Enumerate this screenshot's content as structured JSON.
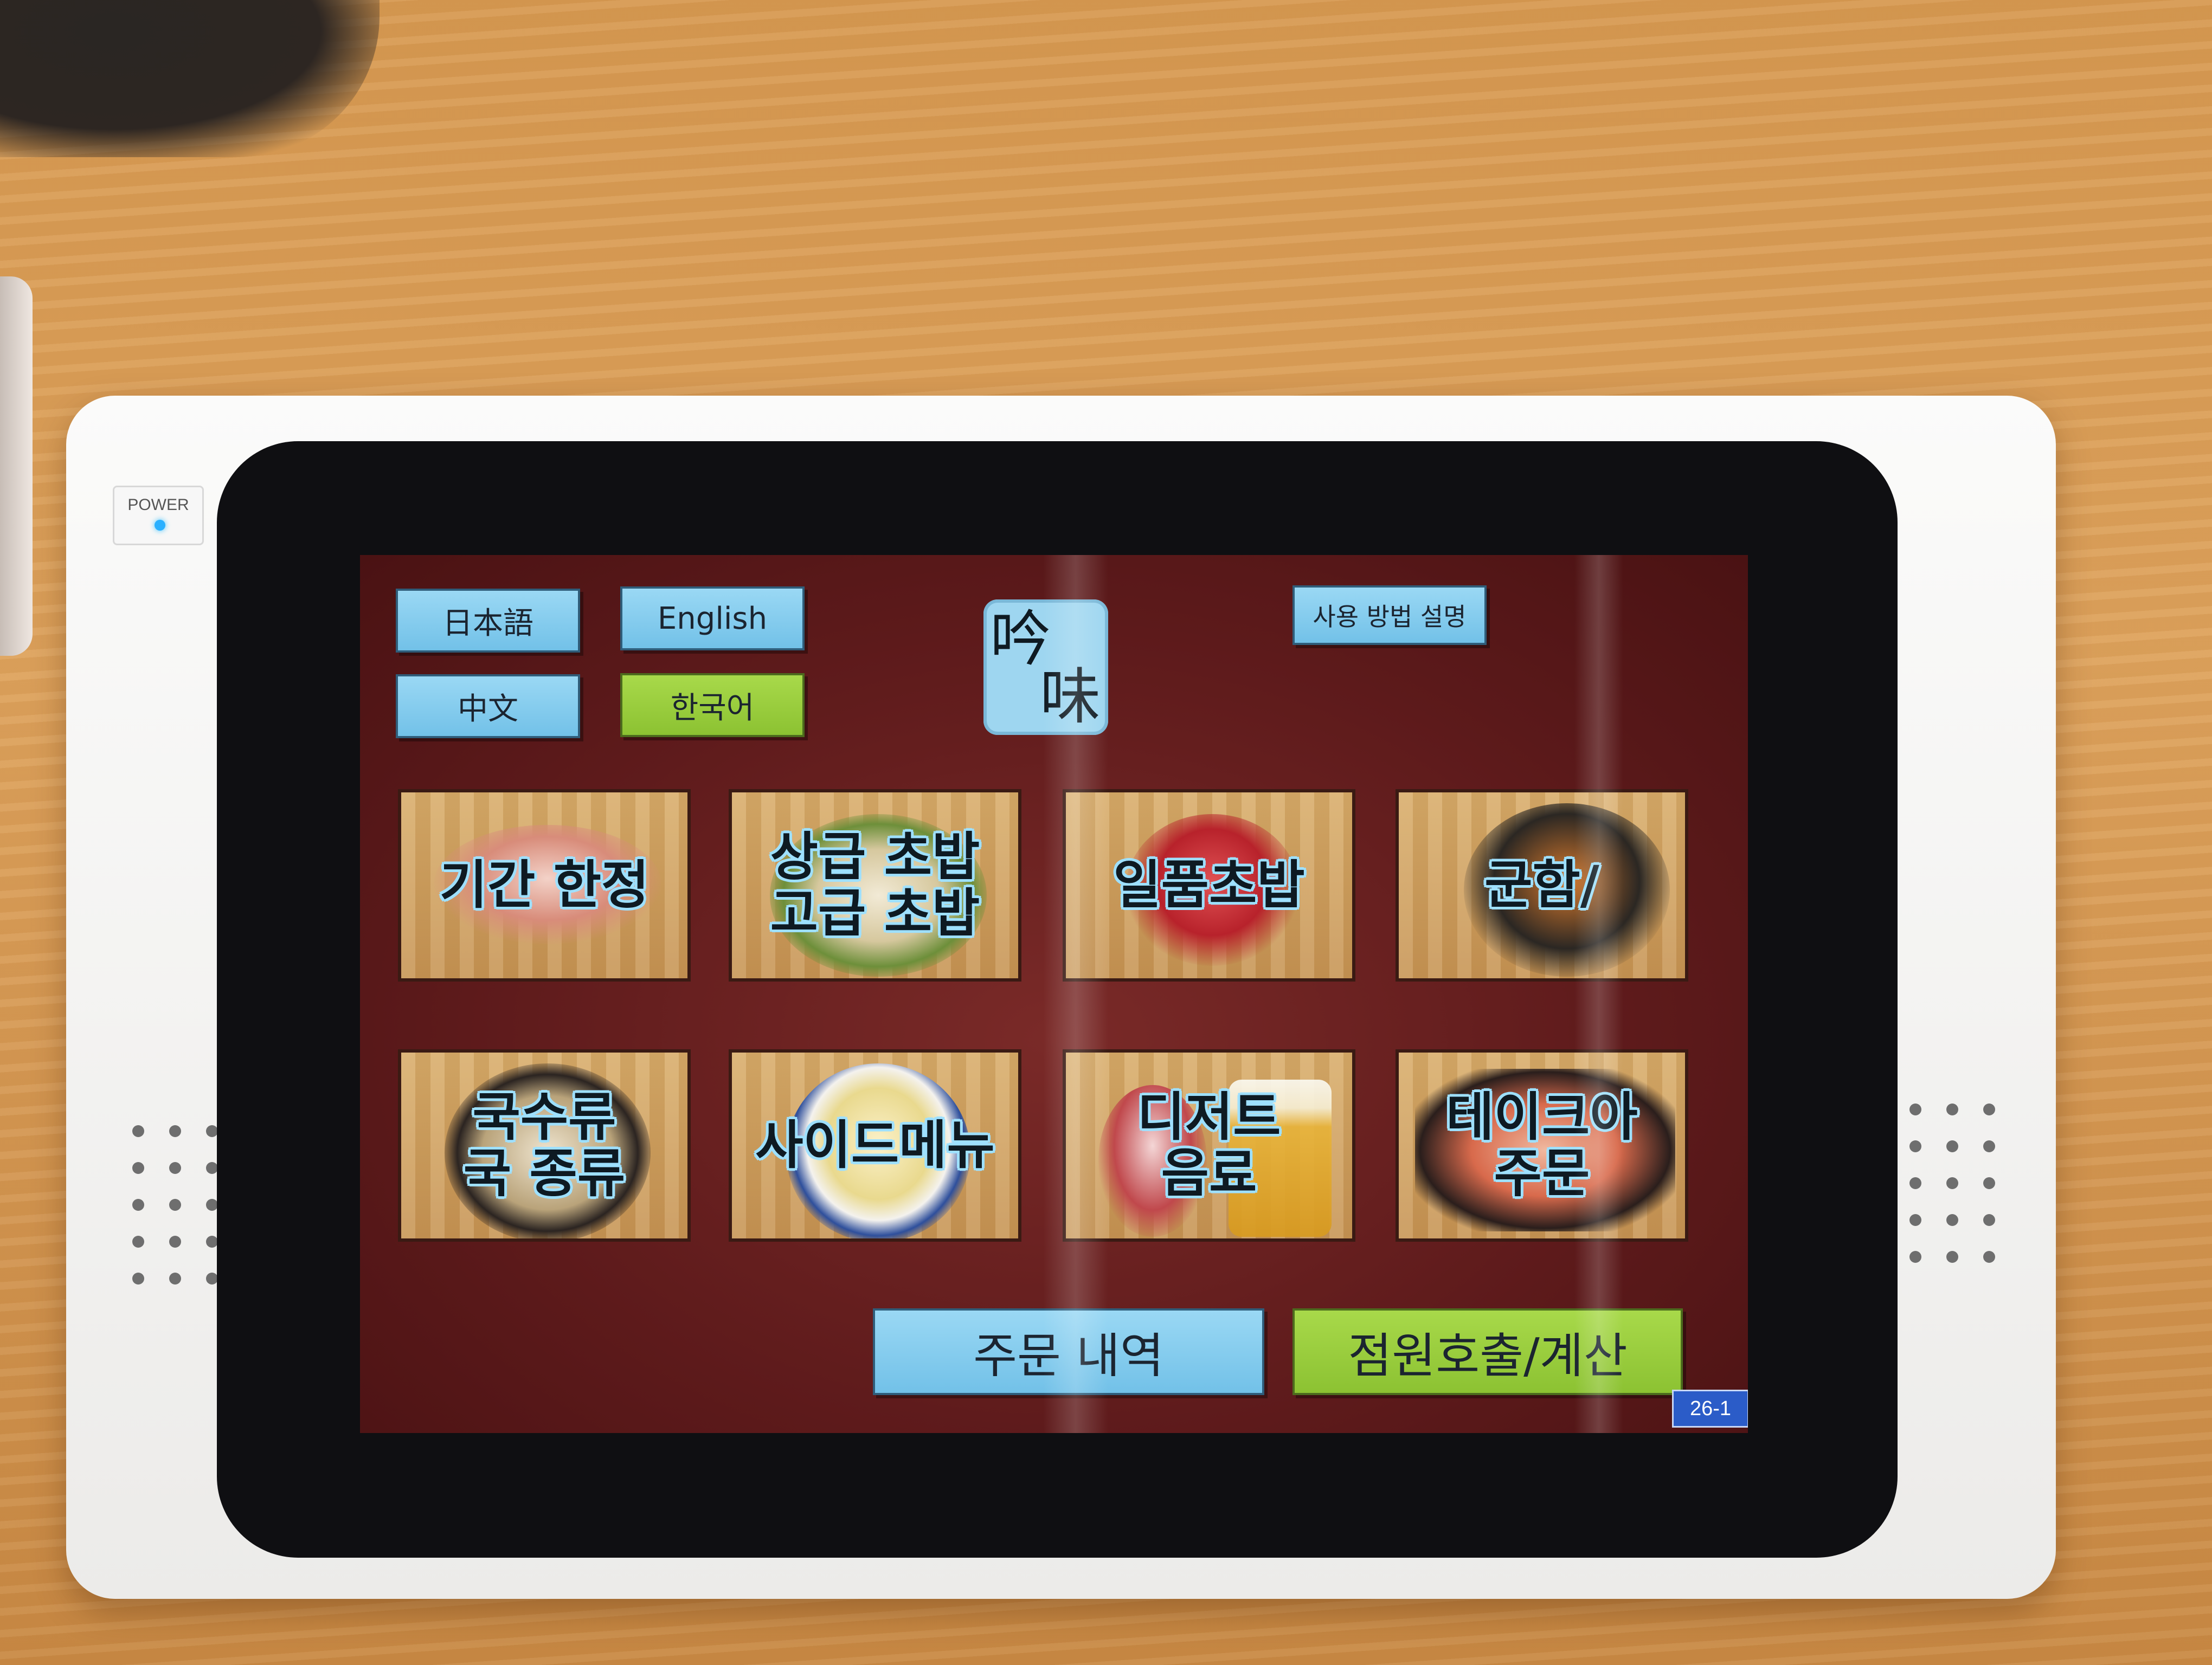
{
  "device": {
    "power_label": "POWER",
    "power_led_color": "#2ab0ff",
    "page_number": "26-1"
  },
  "languages": [
    {
      "label": "日本語",
      "color": "#7fc9ec",
      "selected": false
    },
    {
      "label": "English",
      "color": "#7fc9ec",
      "selected": false
    },
    {
      "label": "中文",
      "color": "#7fc9ec",
      "selected": false
    },
    {
      "label": "한국어",
      "color": "#94c83a",
      "selected": true
    }
  ],
  "logo": {
    "char1": "吟",
    "char2": "味"
  },
  "help_button": {
    "label": "사용 방법 설명"
  },
  "menu_tiles": [
    {
      "label": "기간 한정"
    },
    {
      "label": "상급 초밥\n고급 초밥"
    },
    {
      "label": "일품초밥"
    },
    {
      "label": "군함/"
    },
    {
      "label": "국수류\n국 종류"
    },
    {
      "label": "사이드메뉴"
    },
    {
      "label": "디저트\n음료"
    },
    {
      "label": "테이크아\n주문"
    }
  ],
  "footer": {
    "order_history_label": "주문 내역",
    "call_staff_label": "점원호출/계산"
  },
  "colors": {
    "screen_bg": "#5d1a1b",
    "button_blue": "#7fc9ec",
    "button_green": "#94c83a"
  }
}
